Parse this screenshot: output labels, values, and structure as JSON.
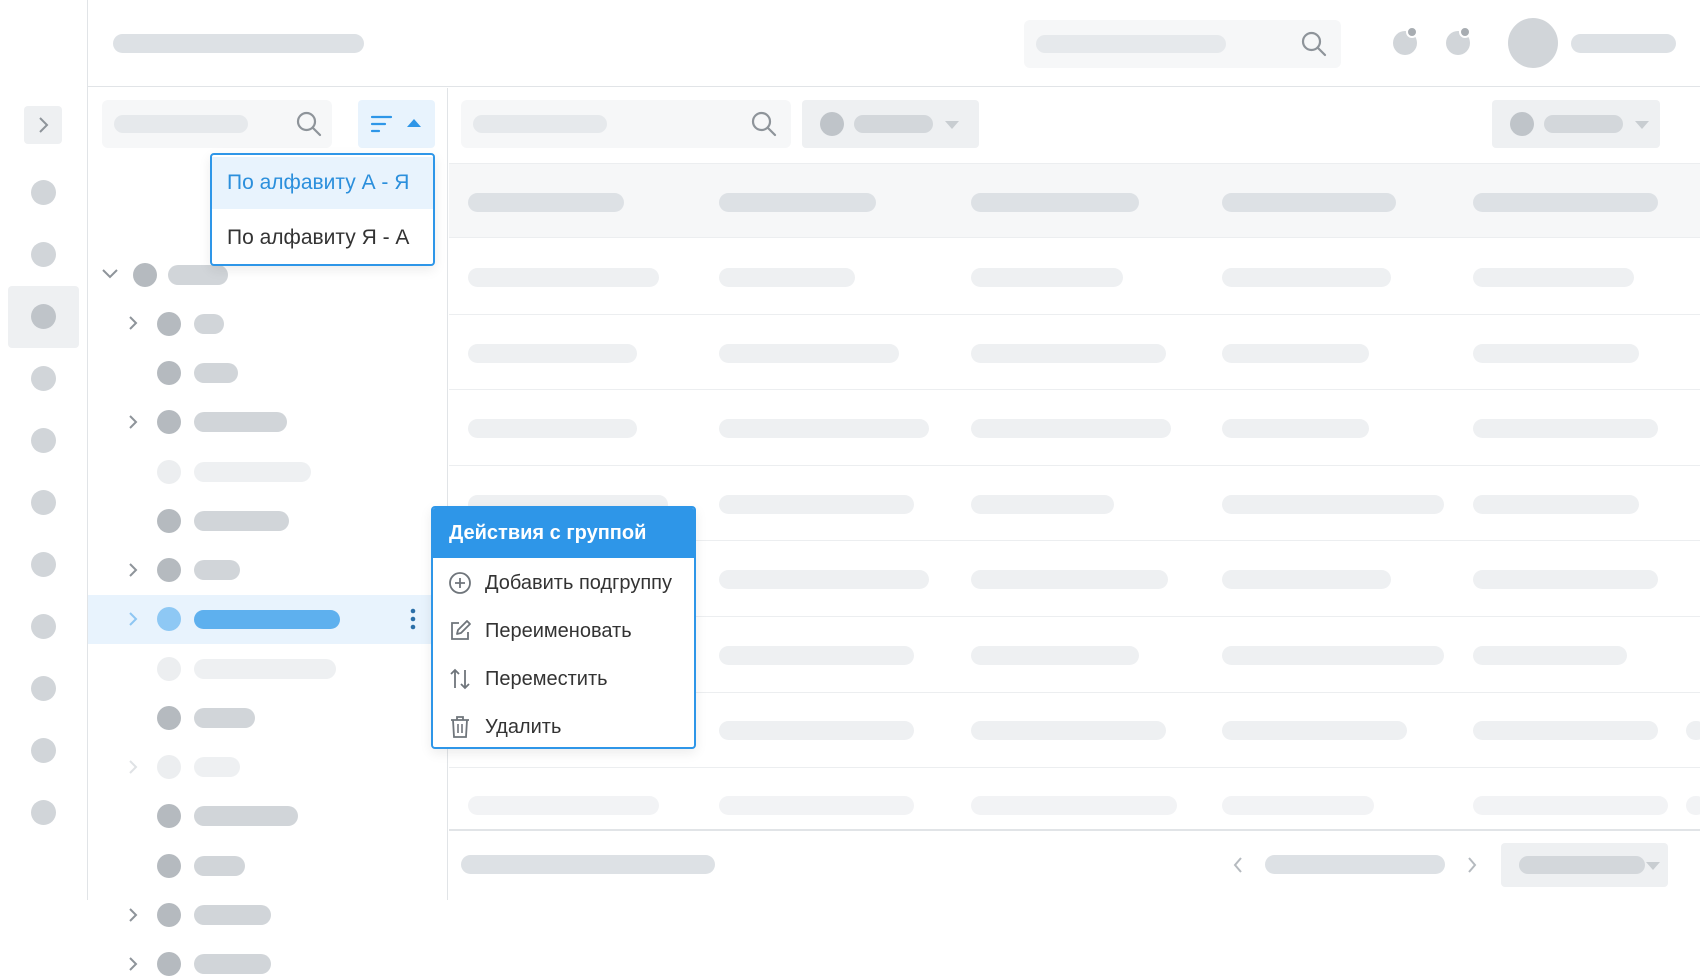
{
  "sort_menu": {
    "options": [
      {
        "label": "По алфавиту А - Я",
        "active": true
      },
      {
        "label": "По алфавиту Я - А",
        "active": false
      }
    ]
  },
  "group_menu": {
    "title": "Действия с группой",
    "items": [
      {
        "label": "Добавить подгруппу",
        "icon": "plus-circle-icon"
      },
      {
        "label": "Переименовать",
        "icon": "edit-icon"
      },
      {
        "label": "Переместить",
        "icon": "move-icon"
      },
      {
        "label": "Удалить",
        "icon": "trash-icon"
      }
    ]
  },
  "colors": {
    "accent": "#2e96e8",
    "selected_row_bg": "#e8f3fd",
    "skeleton": "#dde1e5"
  }
}
